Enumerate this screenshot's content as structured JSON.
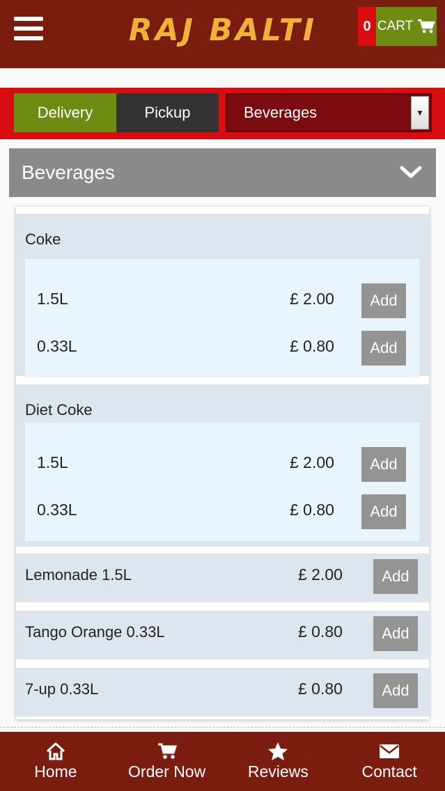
{
  "header": {
    "logo": "RAJ BALTI",
    "cart_count": "0",
    "cart_label": "CART"
  },
  "order_bar": {
    "delivery": "Delivery",
    "pickup": "Pickup",
    "category_select": "Beverages"
  },
  "category": {
    "title": "Beverages"
  },
  "items": [
    {
      "name": "Coke",
      "variants": [
        {
          "name": "1.5L",
          "price": "£ 2.00",
          "add": "Add"
        },
        {
          "name": "0.33L",
          "price": "£ 0.80",
          "add": "Add"
        }
      ]
    },
    {
      "name": "Diet Coke",
      "variants": [
        {
          "name": "1.5L",
          "price": "£ 2.00",
          "add": "Add"
        },
        {
          "name": "0.33L",
          "price": "£ 0.80",
          "add": "Add"
        }
      ]
    }
  ],
  "single_items": [
    {
      "name": "Lemonade 1.5L",
      "price": "£ 2.00",
      "add": "Add"
    },
    {
      "name": "Tango Orange 0.33L",
      "price": "£ 0.80",
      "add": "Add"
    },
    {
      "name": "7-up 0.33L",
      "price": "£ 0.80",
      "add": "Add"
    }
  ],
  "footer": {
    "home": "Home",
    "order_now": "Order Now",
    "reviews": "Reviews",
    "contact": "Contact"
  },
  "colors": {
    "header_bg": "#7a1d0f",
    "logo": "#f2b134",
    "accent_red": "#d70d12",
    "accent_green": "#6e8c12"
  }
}
